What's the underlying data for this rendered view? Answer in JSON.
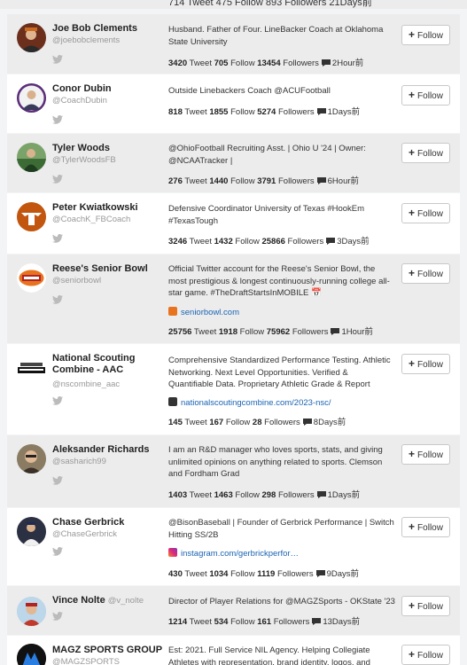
{
  "partial_top": {
    "stats": "714 Tweet 475 Follow 893 Followers  21Days前"
  },
  "follow_label": "Follow",
  "tweet_label": "Tweet",
  "follow_count_label": "Follow",
  "followers_label": "Followers",
  "users": [
    {
      "name": "Joe Bob Clements",
      "handle": "@joebobclements",
      "bio": "Husband. Father of Four. LineBacker Coach at Oklahoma State University",
      "link": "",
      "tweets": "3420",
      "follows": "705",
      "followers": "13454",
      "time": "2Hour前"
    },
    {
      "name": "Conor Dubin",
      "handle": "@CoachDubin",
      "bio": "Outside Linebackers Coach @ACUFootball",
      "link": "",
      "tweets": "818",
      "follows": "1855",
      "followers": "5274",
      "time": "1Days前"
    },
    {
      "name": "Tyler Woods",
      "handle": "@TylerWoodsFB",
      "bio": "@OhioFootball Recruiting Asst. | Ohio U '24 | Owner: @NCAATracker |",
      "link": "",
      "tweets": "276",
      "follows": "1440",
      "followers": "3791",
      "time": "6Hour前"
    },
    {
      "name": "Peter Kwiatkowski",
      "handle": "@CoachK_FBCoach",
      "bio": "Defensive Coordinator University of Texas #HookEm #TexasTough",
      "link": "",
      "tweets": "3246",
      "follows": "1432",
      "followers": "25866",
      "time": "3Days前"
    },
    {
      "name": "Reese's Senior Bowl",
      "handle": "@seniorbowl",
      "bio": "Official Twitter account for the Reese's Senior Bowl, the most prestigious & longest continuously-running college all-star game. #TheDraftStartsInMOBILE 📅",
      "link": "seniorbowl.com",
      "tweets": "25756",
      "follows": "1918",
      "followers": "75962",
      "time": "1Hour前"
    },
    {
      "name": "National Scouting Combine - AAC",
      "handle": "@nscombine_aac",
      "bio": "Comprehensive Standardized Performance Testing. Athletic Networking. Next Level Opportunities. Verified & Quantifiable Data. Proprietary Athletic Grade & Report",
      "link": "nationalscoutingcombine.com/2023-nsc/",
      "tweets": "145",
      "follows": "167",
      "followers": "28",
      "time": "8Days前"
    },
    {
      "name": "Aleksander Richards",
      "handle": "@sasharich99",
      "bio": "I am an R&D manager who loves sports, stats, and giving unlimited opinions on anything related to sports. Clemson and Fordham Grad",
      "link": "",
      "tweets": "1403",
      "follows": "1463",
      "followers": "298",
      "time": "1Days前"
    },
    {
      "name": "Chase Gerbrick",
      "handle": "@ChaseGerbrick",
      "bio": "@BisonBaseball | Founder of Gerbrick Performance | Switch Hitting SS/2B",
      "link": "instagram.com/gerbrickperfor…",
      "tweets": "430",
      "follows": "1034",
      "followers": "1119",
      "time": "9Days前"
    },
    {
      "name": "Vince Nolte",
      "handle": "@v_nolte",
      "bio": "Director of Player Relations for @MAGZSports - OKState '23",
      "link": "",
      "tweets": "1214",
      "follows": "534",
      "followers": "161",
      "time": "13Days前"
    },
    {
      "name": "MAGZ SPORTS GROUP",
      "handle": "@MAGZSPORTS",
      "bio": "Est: 2021. Full Service NIL Agency. Helping Collegiate Athletes with representation, brand identity, logos, and",
      "link": "",
      "tweets": "",
      "follows": "",
      "followers": "",
      "time": ""
    }
  ],
  "colors": {
    "link": "#1a64b3",
    "row_gray": "#ececed",
    "row_white": "#ffffff",
    "page_bg": "#f3f4f5"
  }
}
